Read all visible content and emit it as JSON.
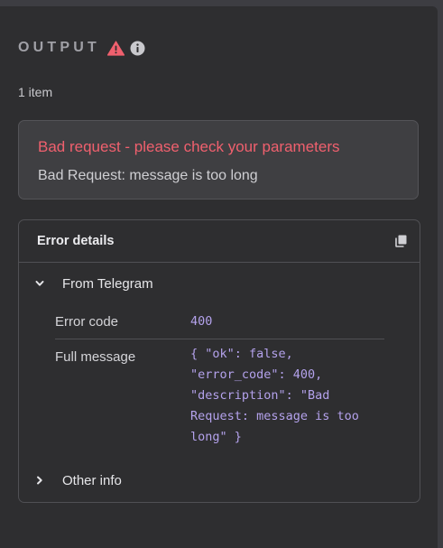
{
  "header": {
    "title": "OUTPUT",
    "warn_icon": "warning-triangle-icon",
    "info_icon": "info-circle-icon"
  },
  "item_count": "1 item",
  "error": {
    "title": "Bad request - please check your parameters",
    "description": "Bad Request: message is too long",
    "title_color": "#f0606e"
  },
  "details": {
    "title": "Error details",
    "copy_icon": "copy-icon",
    "sections": [
      {
        "label": "From Telegram",
        "expanded": true,
        "fields": [
          {
            "label": "Error code",
            "value": "400"
          },
          {
            "label": "Full message",
            "value": "{ \"ok\": false, \"error_code\": 400, \"description\": \"Bad Request: message is too long\" }"
          }
        ]
      },
      {
        "label": "Other info",
        "expanded": false
      }
    ]
  },
  "colors": {
    "value_text": "#b4a2ec",
    "warning": "#f0606e"
  }
}
